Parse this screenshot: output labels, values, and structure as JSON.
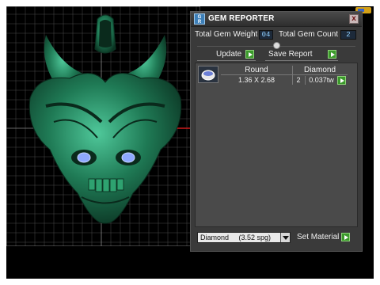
{
  "panel": {
    "title": "GEM REPORTER",
    "logo_text": "GEM\nRPT",
    "close_label": "x",
    "total_weight_label": "Total Gem Weight",
    "total_weight_value": "04",
    "total_count_label": "Total Gem Count",
    "total_count_value": "2",
    "update_label": "Update",
    "save_report_label": "Save Report",
    "list": {
      "columns": [
        "Round",
        "Diamond"
      ],
      "rows": [
        {
          "thumbnail": "gem-thumbnail",
          "size": "1.36 X 2.68",
          "count": "2",
          "weight": "0.037tw"
        }
      ]
    },
    "material_select": "Diamond     (3.52 spg)",
    "set_material_label": "Set Material"
  },
  "colors": {
    "model": "#1f7a55",
    "eyes": "#8ea8ff",
    "grid_line": "#5a5a5a",
    "axis_red": "#cc1a1a",
    "go_button": "#3b9a2b"
  }
}
